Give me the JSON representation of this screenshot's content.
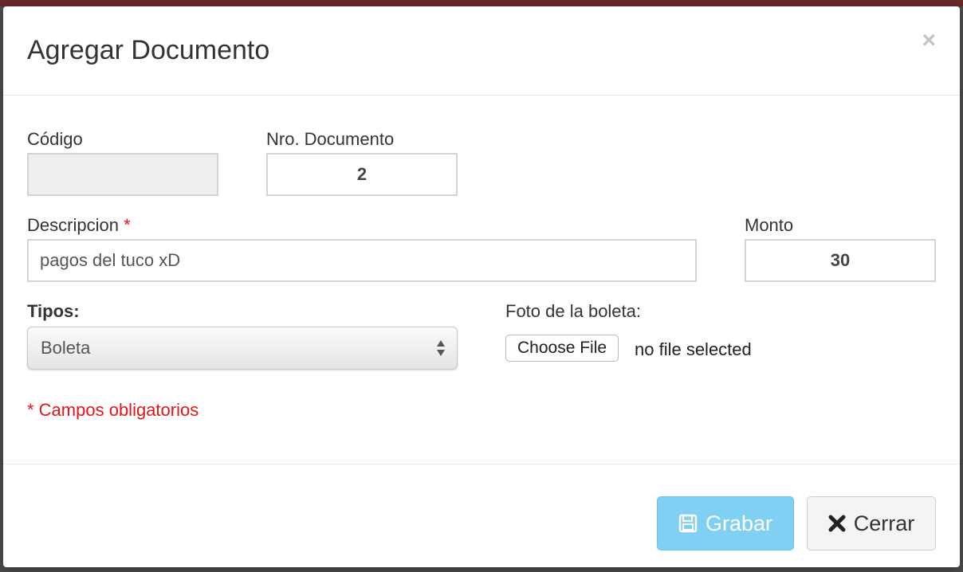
{
  "modal": {
    "title": "Agregar Documento",
    "close_glyph": "×"
  },
  "form": {
    "codigo": {
      "label": "Código",
      "value": ""
    },
    "nro_documento": {
      "label": "Nro. Documento",
      "value": "2"
    },
    "descripcion": {
      "label": "Descripcion",
      "required_marker": "*",
      "value": "pagos del tuco xD"
    },
    "monto": {
      "label": "Monto",
      "value": "30"
    },
    "tipos": {
      "label": "Tipos:",
      "selected": "Boleta"
    },
    "foto": {
      "label": "Foto de la boleta:",
      "button_label": "Choose File",
      "status": "no file selected"
    },
    "required_note": "* Campos obligatorios"
  },
  "footer": {
    "save_label": "Grabar",
    "close_label": "Cerrar"
  },
  "colors": {
    "required": "#e2151b",
    "primary_button": "#80d0f4"
  },
  "icons": {
    "save": "floppy-disk-icon",
    "close": "x-icon"
  }
}
